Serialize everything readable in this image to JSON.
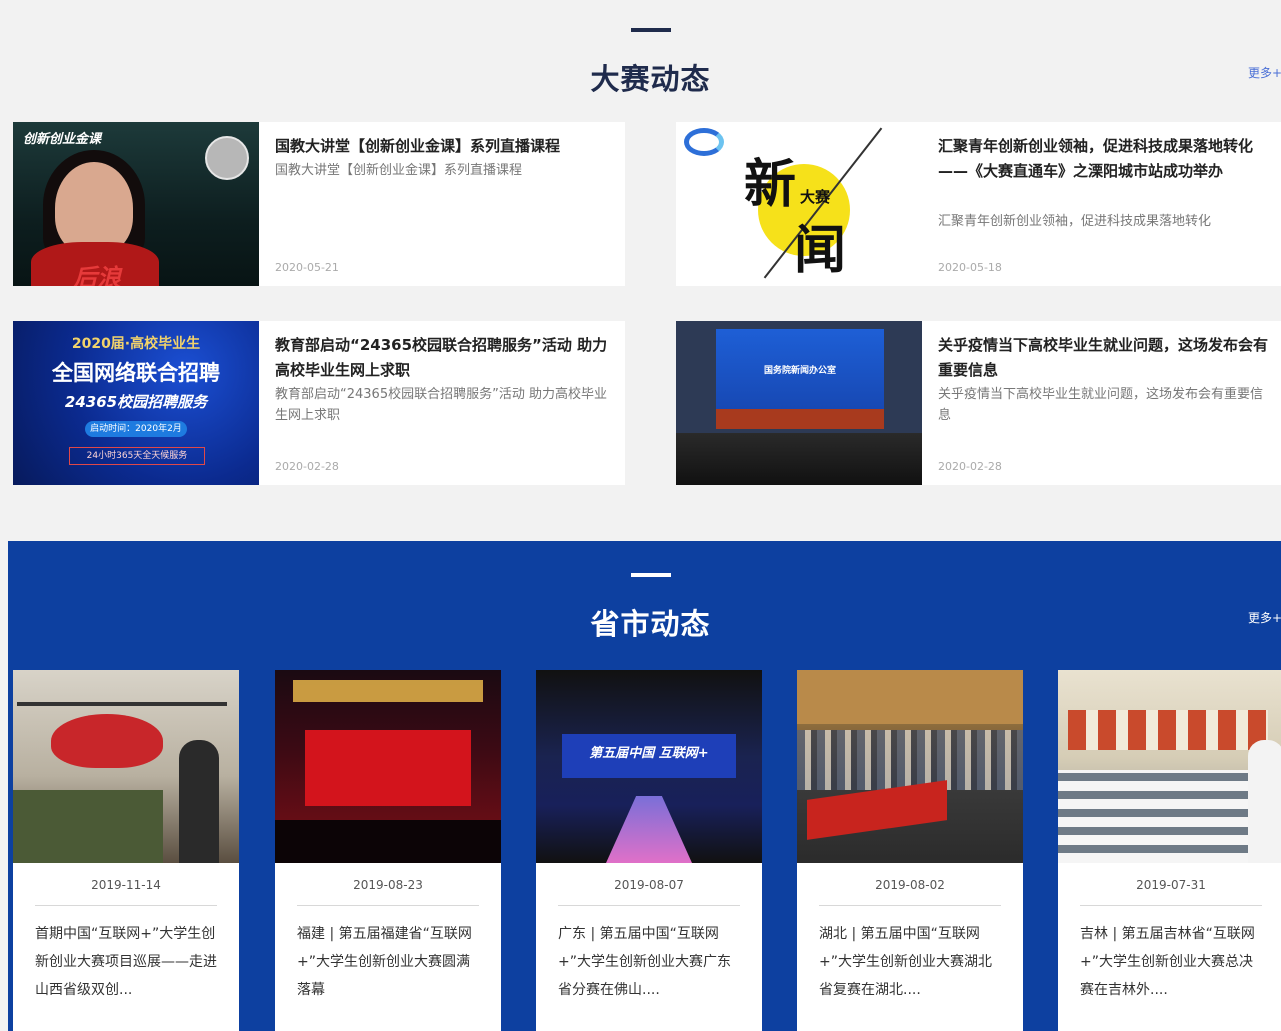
{
  "competition_news": {
    "title": "大赛动态",
    "more": "更多+",
    "items": [
      {
        "title": "国教大讲堂【创新创业金课】系列直播课程",
        "summary": "国教大讲堂【创新创业金课】系列直播课程",
        "date": "2020-05-21",
        "thumb": {
          "caption": "创新创业金课",
          "brush": "后浪",
          "icon": "course-poster-thumbnail"
        }
      },
      {
        "title": "汇聚青年创新创业领袖，促进科技成果落地转化 ——《大赛直通车》之溧阳城市站成功举办",
        "summary": "汇聚青年创新创业领袖，促进科技成果落地转化",
        "date": "2020-05-18",
        "thumb": {
          "char1": "新",
          "char2": "闻",
          "small": "大赛",
          "icon": "news-logo-thumbnail"
        }
      },
      {
        "title": "教育部启动“24365校园联合招聘服务”活动 助力高校毕业生网上求职",
        "summary": "教育部启动“24365校园联合招聘服务”活动 助力高校毕业生网上求职",
        "date": "2020-02-28",
        "thumb": {
          "line1": "2020届·高校毕业生",
          "line2": "全国网络联合招聘",
          "line3": "24365校园招聘服务",
          "line4": "启动时间：2020年2月",
          "line5": "24小时365天全天候服务",
          "icon": "job-fair-poster-thumbnail"
        }
      },
      {
        "title": "关乎疫情当下高校毕业生就业问题，这场发布会有重要信息",
        "summary": "关乎疫情当下高校毕业生就业问题，这场发布会有重要信息",
        "date": "2020-02-28",
        "thumb": {
          "screen": "国务院新闻办公室",
          "icon": "press-conference-photo"
        }
      }
    ]
  },
  "provincial_news": {
    "title": "省市动态",
    "more": "更多+",
    "items": [
      {
        "date": "2019-11-14",
        "title": "首期中国“互联网+”大学生创新创业大赛项目巡展——走进山西省级双创...",
        "icon": "exhibition-photo"
      },
      {
        "date": "2019-08-23",
        "title": "福建 | 第五届福建省“互联网+”大学生创新创业大赛圆满落幕",
        "icon": "ceremony-stage-photo"
      },
      {
        "date": "2019-08-07",
        "title": "广东 | 第五届中国“互联网+”大学生创新创业大赛广东省分赛在佛山....",
        "icon": "competition-stage-photo",
        "screen": "第五届中国 互联网+"
      },
      {
        "date": "2019-08-02",
        "title": "湖北 | 第五届中国“互联网+”大学生创新创业大赛湖北省复赛在湖北....",
        "icon": "auditorium-photo"
      },
      {
        "date": "2019-07-31",
        "title": "吉林 | 第五届吉林省“互联网+”大学生创新创业大赛总决赛在吉林外....",
        "icon": "meeting-room-photo"
      }
    ]
  },
  "colors": {
    "page_background": "#f2f2f2",
    "provincial_background": "#0d40a0",
    "heading_dark": "#1f2b4c",
    "more_link": "#4a6fd6"
  }
}
